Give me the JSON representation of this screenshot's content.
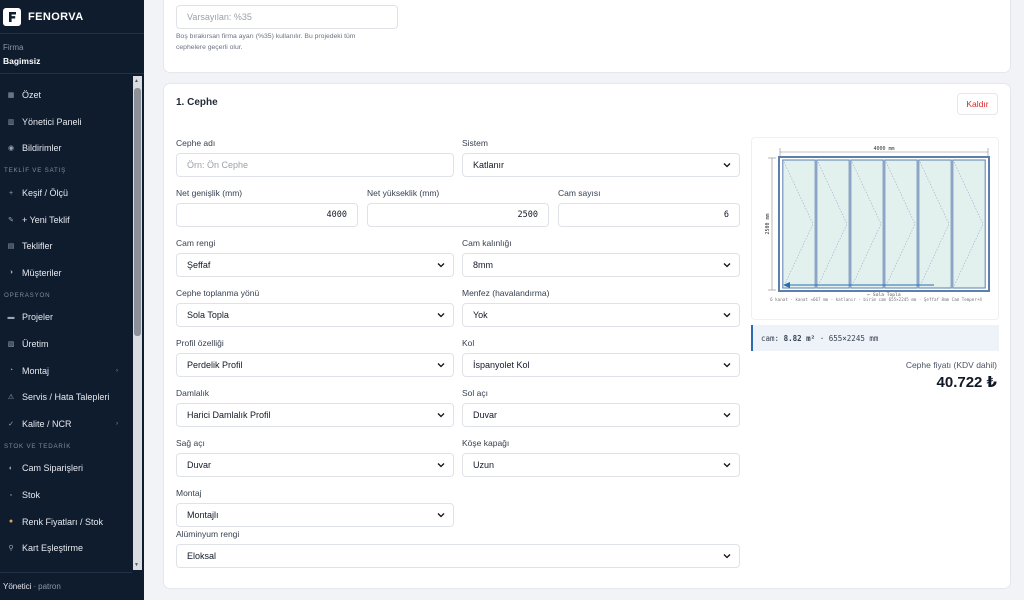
{
  "brand": {
    "name": "FENORVA"
  },
  "firm": {
    "label": "Firma",
    "value": "Bagimsiz"
  },
  "nav": {
    "items_top": [
      {
        "label": "Özet",
        "icon": "grid-icon"
      },
      {
        "label": "Yönetici Paneli",
        "icon": "chart-icon"
      },
      {
        "label": "Bildirimler",
        "icon": "bell-icon"
      }
    ],
    "section_sales": "TEKLİF VE SATIŞ",
    "items_sales": [
      {
        "label": "Keşif / Ölçü",
        "icon": "plus-icon"
      },
      {
        "label": "+ Yeni Teklif",
        "icon": "pen-icon"
      },
      {
        "label": "Teklifler",
        "icon": "doc-icon"
      },
      {
        "label": "Müşteriler",
        "icon": "users-icon"
      }
    ],
    "section_ops": "OPERASYON",
    "items_ops": [
      {
        "label": "Projeler",
        "icon": "folder-icon"
      },
      {
        "label": "Üretim",
        "icon": "factory-icon"
      },
      {
        "label": "Montaj",
        "icon": "wrench-icon"
      },
      {
        "label": "Servis / Hata Talepleri",
        "icon": "warning-icon"
      },
      {
        "label": "Kalite / NCR",
        "icon": "check-icon"
      }
    ],
    "section_stock": "STOK VE TEDARİK",
    "items_stock": [
      {
        "label": "Cam Siparişleri",
        "icon": "glass-icon"
      },
      {
        "label": "Stok",
        "icon": "box-icon"
      },
      {
        "label": "Renk Fiyatları / Stok",
        "icon": "palette-icon"
      },
      {
        "label": "Kart Eşleştirme",
        "icon": "link-icon"
      }
    ]
  },
  "footer": {
    "role": "Yönetici",
    "separator": "·",
    "user": "patron"
  },
  "top_card": {
    "input_placeholder": "Varsayılan: %35",
    "hint": "Boş bırakırsan firma ayarı (%35) kullanılır. Bu projedeki tüm cephelere geçerli olur."
  },
  "facade": {
    "title": "1. Cephe",
    "remove_label": "Kaldır",
    "fields": {
      "name": {
        "label": "Cephe adı",
        "placeholder": "Örn: Ön Cephe"
      },
      "system": {
        "label": "Sistem",
        "value": "Katlanır"
      },
      "width": {
        "label": "Net genişlik (mm)",
        "value": "4000"
      },
      "height": {
        "label": "Net yükseklik (mm)",
        "value": "2500"
      },
      "glass_count": {
        "label": "Cam sayısı",
        "value": "6"
      },
      "glass_color": {
        "label": "Cam rengi",
        "value": "Şeffaf"
      },
      "glass_thickness": {
        "label": "Cam kalınlığı",
        "value": "8mm"
      },
      "collect_direction": {
        "label": "Cephe toplanma yönü",
        "value": "Sola Topla"
      },
      "vent": {
        "label": "Menfez (havalandırma)",
        "value": "Yok"
      },
      "profile": {
        "label": "Profil özelliği",
        "value": "Perdelik Profil"
      },
      "handle": {
        "label": "Kol",
        "value": "İspanyolet Kol"
      },
      "drip": {
        "label": "Damlalık",
        "value": "Harici Damlalık Profil"
      },
      "left_angle": {
        "label": "Sol açı",
        "value": "Duvar"
      },
      "right_angle": {
        "label": "Sağ açı",
        "value": "Duvar"
      },
      "corner_cap": {
        "label": "Köşe kapağı",
        "value": "Uzun"
      },
      "mounting": {
        "label": "Montaj",
        "value": "Montajlı"
      },
      "alu_color": {
        "label": "Alüminyum rengi",
        "value": "Eloksal"
      }
    },
    "preview": {
      "width_dim": "4000 mm",
      "height_dim": "2500 mm",
      "direction": "← Sola Topla",
      "caption": "6 kanat · kanat ≈667 mm · katlanır · birim cam 655×2245 mm · Şeffaf 8mm Cam Temper+4",
      "panel_count": 6
    },
    "glass_info": {
      "prefix": "cam:",
      "area": "8.82 m²",
      "size": "· 655×2245 mm"
    },
    "price": {
      "label": "Cephe fiyatı (KDV dahil)",
      "value": "40.722 ₺"
    },
    "colors": {
      "frame": "#5b7fae",
      "glass": "#e2f0ee",
      "accent": "#2b6cb0",
      "danger": "#dc2626"
    }
  }
}
